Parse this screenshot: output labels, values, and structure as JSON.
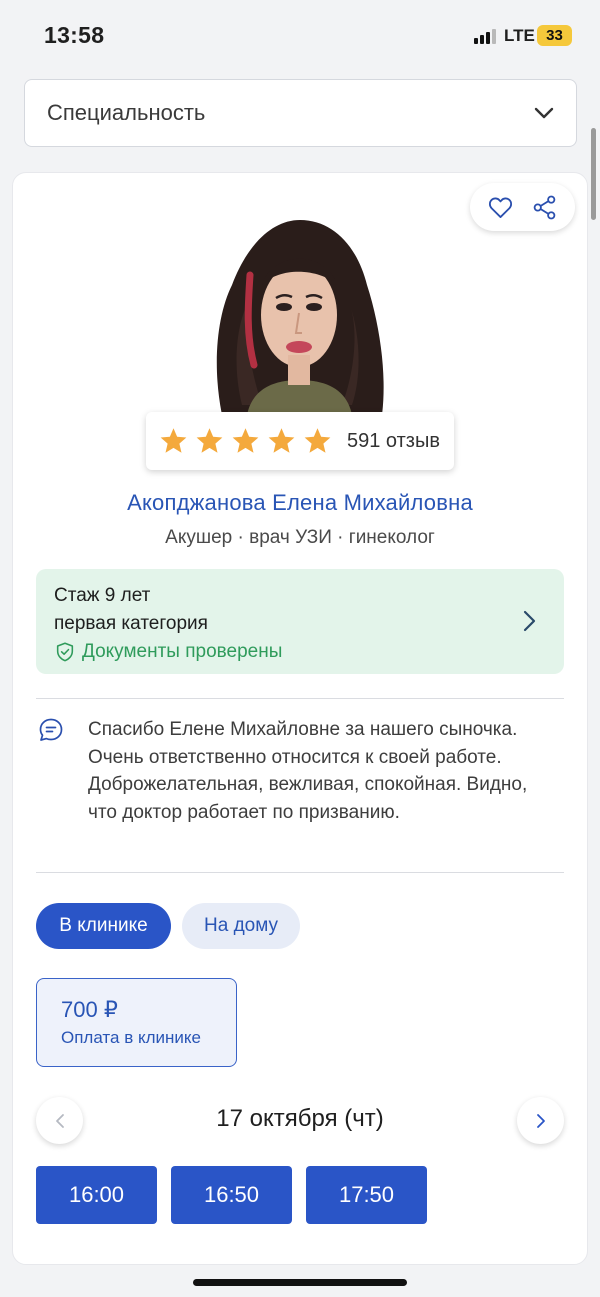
{
  "status_bar": {
    "time": "13:58",
    "network": "LTE",
    "battery": "33"
  },
  "specialty_select": {
    "label": "Специальность"
  },
  "doctor": {
    "name": "Акопджанова Елена Михайловна",
    "specialties": "Акушер · врач УЗИ · гинеколог",
    "rating_stars": 5,
    "reviews_count": "591 отзыв"
  },
  "experience": {
    "years": "Стаж 9 лет",
    "category": "первая категория",
    "verified": "Документы проверены"
  },
  "review": {
    "text": "Спасибо Елене Михайловне за нашего сыночка. Очень ответственно относится к своей работе. Доброжелательная, вежливая, спокойная. Видно, что доктор работает по призванию."
  },
  "tabs": [
    {
      "label": "В клинике",
      "active": true
    },
    {
      "label": "На дому",
      "active": false
    }
  ],
  "price": {
    "value": "700 ₽",
    "note": "Оплата в клинике"
  },
  "schedule": {
    "date": "17 октября (чт)",
    "slots": [
      "16:00",
      "16:50",
      "17:50"
    ]
  },
  "colors": {
    "accent": "#2a55c7",
    "star": "#f4a93c",
    "verified_green": "#2f9b5b",
    "experience_bg": "#e3f4ea"
  }
}
